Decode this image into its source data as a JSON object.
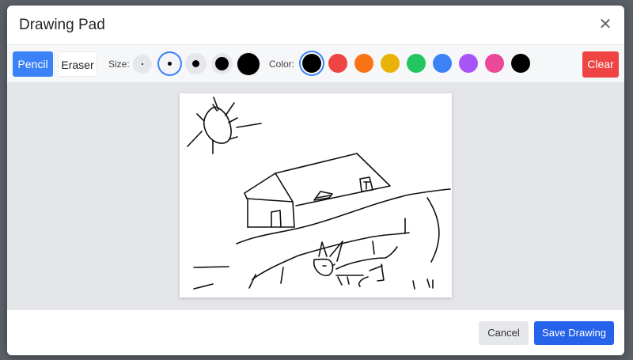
{
  "dialog": {
    "title": "Drawing Pad",
    "close_icon": "close-icon"
  },
  "toolbar": {
    "pencil_label": "Pencil",
    "eraser_label": "Eraser",
    "active_tool": "Pencil",
    "size_label": "Size:",
    "sizes": [
      {
        "name": "size-1",
        "selected": false
      },
      {
        "name": "size-2",
        "selected": true
      },
      {
        "name": "size-3",
        "selected": false
      },
      {
        "name": "size-4",
        "selected": false
      },
      {
        "name": "size-5",
        "selected": false
      }
    ],
    "color_label": "Color:",
    "colors": [
      {
        "hex": "#000000",
        "selected": true
      },
      {
        "hex": "#ef4444",
        "selected": false
      },
      {
        "hex": "#f97316",
        "selected": false
      },
      {
        "hex": "#eab308",
        "selected": false
      },
      {
        "hex": "#22c55e",
        "selected": false
      },
      {
        "hex": "#3b82f6",
        "selected": false
      },
      {
        "hex": "#a855f7",
        "selected": false
      },
      {
        "hex": "#ec4899",
        "selected": false
      },
      {
        "hex": "#000000",
        "selected": false
      }
    ],
    "clear_label": "Clear"
  },
  "canvas": {
    "description_icon": "drawing-canvas"
  },
  "footer": {
    "cancel_label": "Cancel",
    "save_label": "Save Drawing"
  }
}
